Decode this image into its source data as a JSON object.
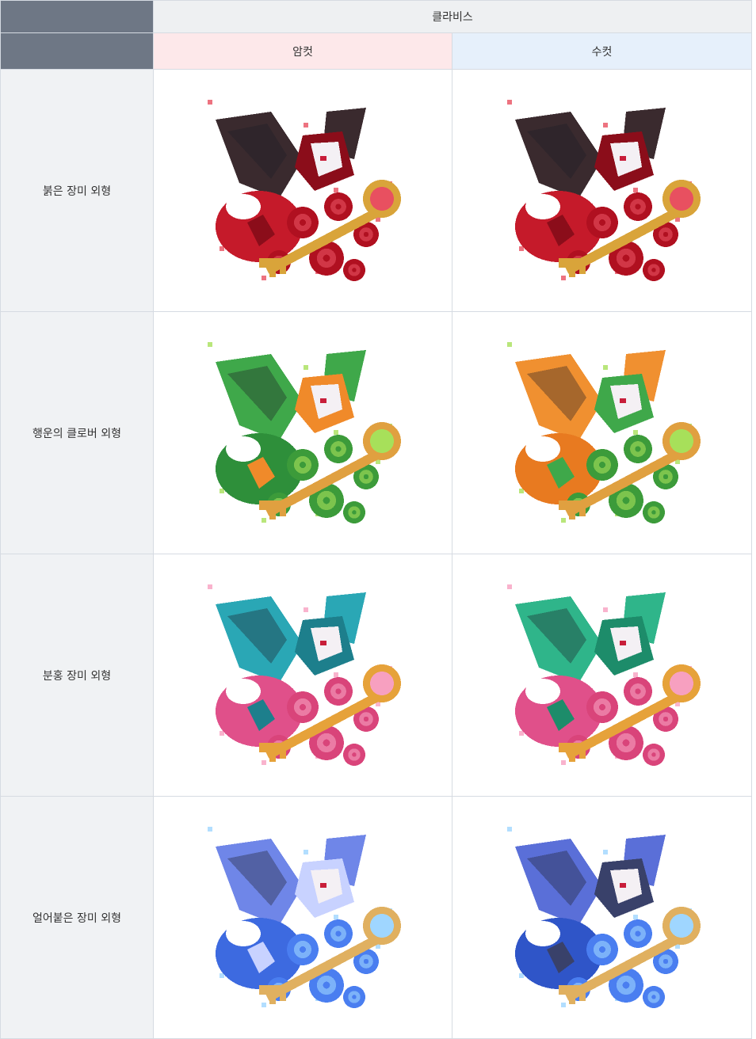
{
  "table": {
    "character": "클라비스",
    "columns": [
      "암컷",
      "수컷"
    ],
    "rows": [
      {
        "label": "붉은 장미 외형",
        "palette_f": {
          "wing": "#3a2a2e",
          "body": "#c51a2a",
          "accent": "#8b0d1a",
          "key": "#d9a43a",
          "flower": "#b01020",
          "glow": "#e85060"
        },
        "palette_m": {
          "wing": "#3a2a2e",
          "body": "#c51a2a",
          "accent": "#8b0d1a",
          "key": "#d9a43a",
          "flower": "#b01020",
          "glow": "#e85060"
        }
      },
      {
        "label": "행운의 클로버 외형",
        "palette_f": {
          "wing": "#3fa84a",
          "body": "#2e8f3a",
          "accent": "#f08a2a",
          "key": "#e0a040",
          "flower": "#3c9b3a",
          "glow": "#a7e05a"
        },
        "palette_m": {
          "wing": "#f09030",
          "body": "#e87a20",
          "accent": "#3fa84a",
          "key": "#e0a040",
          "flower": "#3c9b3a",
          "glow": "#a7e05a"
        }
      },
      {
        "label": "분홍 장미 외형",
        "palette_f": {
          "wing": "#2aa7b5",
          "body": "#e0508a",
          "accent": "#1d7f8c",
          "key": "#e6a23a",
          "flower": "#d9447a",
          "glow": "#f7a0c0"
        },
        "palette_m": {
          "wing": "#2fb58a",
          "body": "#e0508a",
          "accent": "#1d8c6a",
          "key": "#e6a23a",
          "flower": "#d9447a",
          "glow": "#f7a0c0"
        }
      },
      {
        "label": "얼어붙은 장미 외형",
        "palette_f": {
          "wing": "#6f86e8",
          "body": "#3d6ae0",
          "accent": "#c8d2ff",
          "key": "#e0b060",
          "flower": "#4a7ef0",
          "glow": "#9fd6ff"
        },
        "palette_m": {
          "wing": "#5a6fd8",
          "body": "#2f55c8",
          "accent": "#39416a",
          "key": "#e0b060",
          "flower": "#4a7ef0",
          "glow": "#9fd6ff"
        }
      }
    ]
  }
}
